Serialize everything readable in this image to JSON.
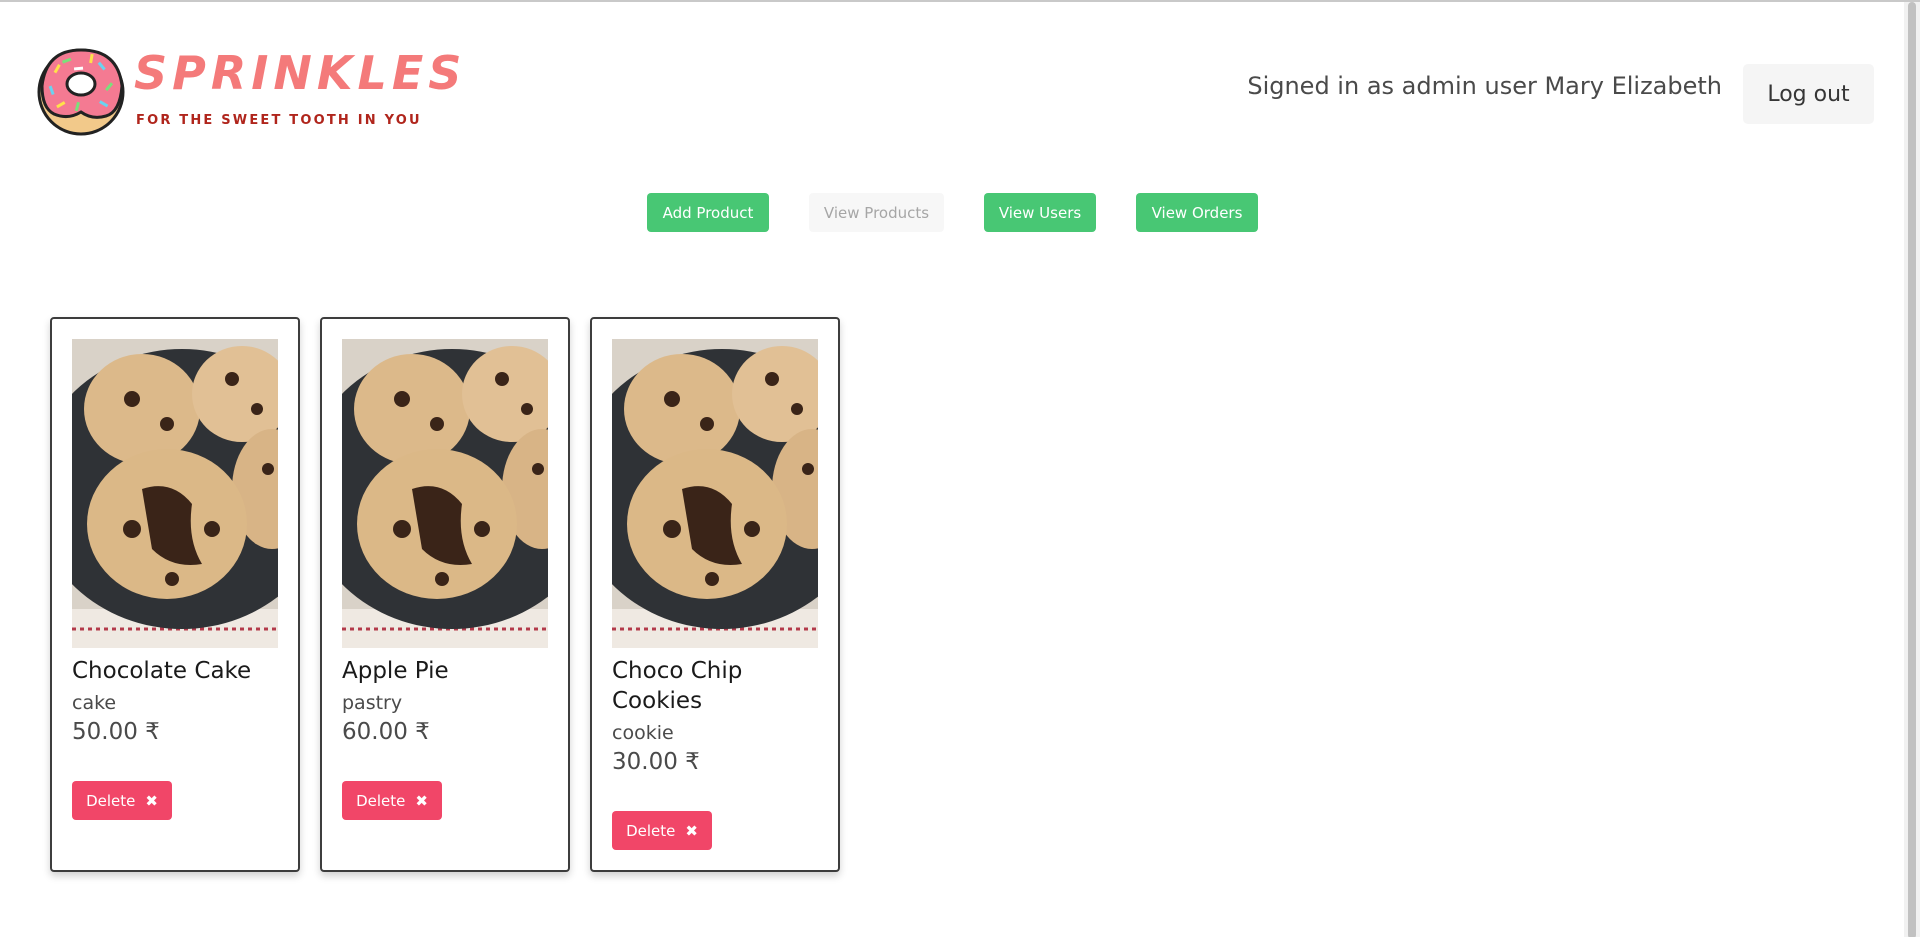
{
  "brand": {
    "name": "SPRINKLES",
    "tagline": "FOR THE SWEET TOOTH IN YOU"
  },
  "header": {
    "signed_in_text": "Signed in as admin user Mary Elizabeth",
    "logout_label": "Log out"
  },
  "nav": {
    "add_product": "Add Product",
    "view_products": "View Products",
    "view_users": "View Users",
    "view_orders": "View Orders"
  },
  "products": [
    {
      "name": "Chocolate Cake",
      "category": "cake",
      "price": "50.00 ₹",
      "delete_label": "Delete"
    },
    {
      "name": "Apple Pie",
      "category": "pastry",
      "price": "60.00 ₹",
      "delete_label": "Delete"
    },
    {
      "name": "Choco Chip Cookies",
      "category": "cookie",
      "price": "30.00 ₹",
      "delete_label": "Delete"
    }
  ],
  "colors": {
    "primary_green": "#48c774",
    "danger_red": "#f14668",
    "brand_pink": "#f47a7a",
    "tagline_red": "#b0251c"
  },
  "icons": {
    "logo": "donut-logo-icon",
    "delete": "close-icon",
    "product_image": "cookie-photo-icon"
  }
}
